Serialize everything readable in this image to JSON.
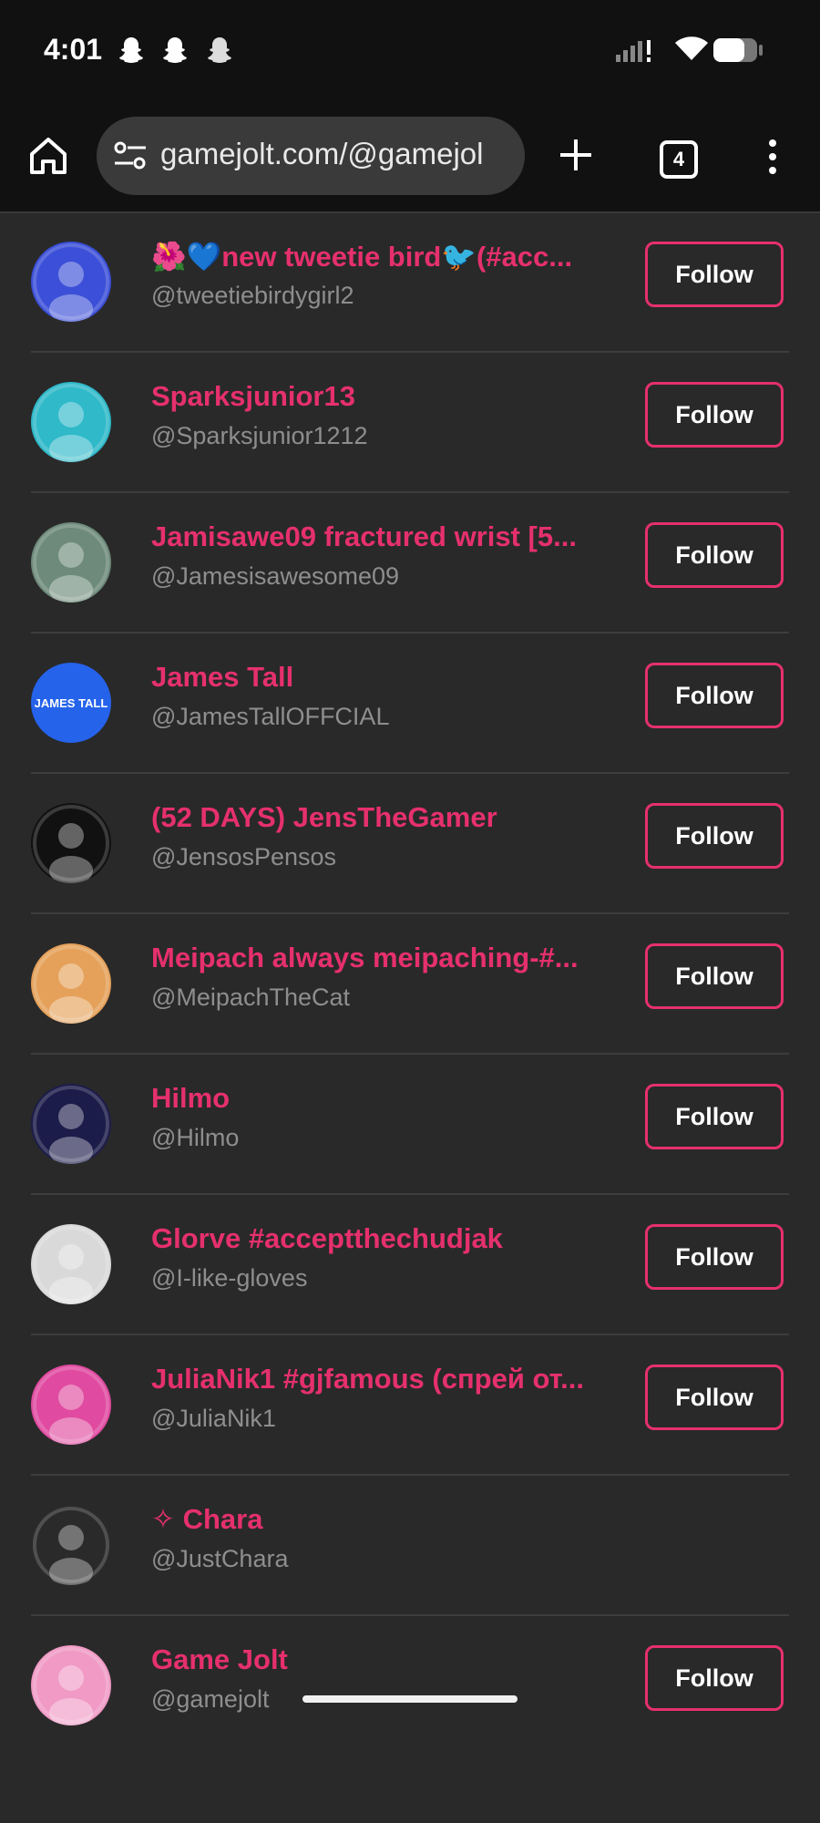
{
  "status_bar": {
    "time": "4:01",
    "notification_icons": [
      "snapchat-icon",
      "snapchat-icon",
      "snapchat-icon"
    ]
  },
  "browser": {
    "url": "gamejolt.com/@gamejol",
    "tab_count": "4"
  },
  "follow_label": "Follow",
  "users": [
    {
      "name": "🌺💙new tweetie bird🐦(#acc...",
      "handle": "@tweetiebirdygirl2",
      "avatar_color": "#3b4fd8",
      "has_follow": true
    },
    {
      "name": "Sparksjunior13",
      "handle": "@Sparksjunior1212",
      "avatar_color": "#2fb9c9",
      "has_follow": true
    },
    {
      "name": "Jamisawe09 fractured wrist [5...",
      "handle": "@Jamesisawesome09",
      "avatar_color": "#6d8a7a",
      "has_follow": true
    },
    {
      "name": "James Tall",
      "handle": "@JamesTallOFFCIAL",
      "avatar_color": "#2563eb",
      "avatar_text": "JAMES TALL",
      "has_follow": true
    },
    {
      "name": "(52 DAYS) JensTheGamer",
      "handle": "@JensosPensos",
      "avatar_color": "#111111",
      "has_follow": true
    },
    {
      "name": "Meipach always meipaching-#...",
      "handle": "@MeipachTheCat",
      "avatar_color": "#e5a15a",
      "has_follow": true
    },
    {
      "name": "Hilmo",
      "handle": "@Hilmo",
      "avatar_color": "#1c1c4a",
      "has_follow": true
    },
    {
      "name": "Glorve #acceptthechudjak",
      "handle": "@I-like-gloves",
      "avatar_color": "#d9d9d9",
      "has_follow": true
    },
    {
      "name": "JuliaNik1 #gjfamous (спрей от...",
      "handle": "@JuliaNik1",
      "avatar_color": "#e04aa0",
      "has_follow": true
    },
    {
      "name": "✧ Chara",
      "handle": "@JustChara",
      "avatar_color": "#2a2a2a",
      "has_follow": false
    },
    {
      "name": "Game Jolt",
      "handle": "@gamejolt",
      "avatar_color": "#f09ac5",
      "has_follow": true
    }
  ]
}
